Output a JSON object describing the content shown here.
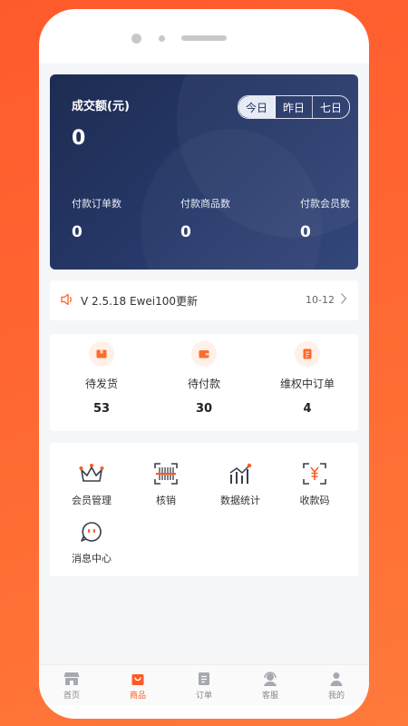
{
  "stats": {
    "amount_label": "成交额(元)",
    "amount_value": "0",
    "segments": [
      {
        "label": "今日",
        "active": true
      },
      {
        "label": "昨日",
        "active": false
      },
      {
        "label": "七日",
        "active": false
      }
    ],
    "metrics": [
      {
        "label": "付款订单数",
        "value": "0"
      },
      {
        "label": "付款商品数",
        "value": "0"
      },
      {
        "label": "付款会员数",
        "value": "0"
      }
    ]
  },
  "notice": {
    "text": "V 2.5.18 Ewei100更新",
    "date": "10-12",
    "icon": "speaker-icon"
  },
  "orders": [
    {
      "label": "待发货",
      "count": "53",
      "icon": "package-icon"
    },
    {
      "label": "待付款",
      "count": "30",
      "icon": "wallet-icon"
    },
    {
      "label": "维权中订单",
      "count": "4",
      "icon": "refund-icon"
    }
  ],
  "tools": [
    {
      "label": "会员管理",
      "icon": "crown-icon"
    },
    {
      "label": "核销",
      "icon": "scan-code-icon"
    },
    {
      "label": "数据统计",
      "icon": "chart-icon"
    },
    {
      "label": "收款码",
      "icon": "yuan-scan-icon"
    },
    {
      "label": "消息中心",
      "icon": "message-icon"
    }
  ],
  "tabs": [
    {
      "label": "首页",
      "icon": "store-icon",
      "active": false
    },
    {
      "label": "商品",
      "icon": "bag-icon",
      "active": true
    },
    {
      "label": "订单",
      "icon": "document-icon",
      "active": false
    },
    {
      "label": "客服",
      "icon": "headset-icon",
      "active": false
    },
    {
      "label": "我的",
      "icon": "user-icon",
      "active": false
    }
  ],
  "colors": {
    "accent": "#ff5a24",
    "card_dark": "#24355f",
    "background": "#ff6230"
  }
}
